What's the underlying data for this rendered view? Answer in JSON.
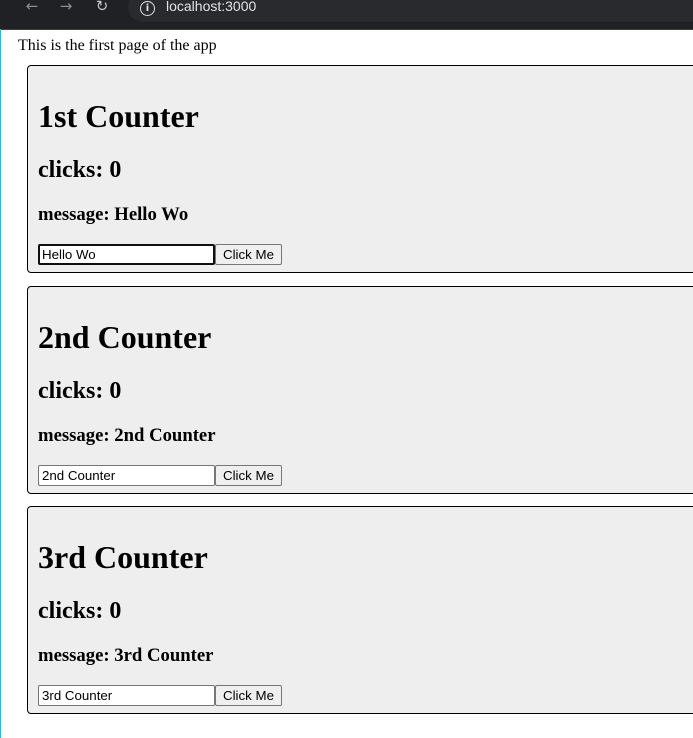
{
  "browser": {
    "back_glyph": "←",
    "forward_glyph": "→",
    "reload_glyph": "↻",
    "info_glyph": "i",
    "url": "localhost:3000"
  },
  "page": {
    "intro": "This is the first page of the app"
  },
  "counters": [
    {
      "title": "1st Counter",
      "clicks_text": "clicks: 0",
      "message_text": "message: Hello Wo",
      "input_value": "Hello Wo",
      "button_label": "Click Me"
    },
    {
      "title": "2nd Counter",
      "clicks_text": "clicks: 0",
      "message_text": "message: 2nd Counter",
      "input_value": "2nd Counter",
      "button_label": "Click Me"
    },
    {
      "title": "3rd Counter",
      "clicks_text": "clicks: 0",
      "message_text": "message: 3rd Counter",
      "input_value": "3rd Counter",
      "button_label": "Click Me"
    }
  ],
  "colors": {
    "card_background": "#eeeeee",
    "browser_bar": "#202124"
  }
}
